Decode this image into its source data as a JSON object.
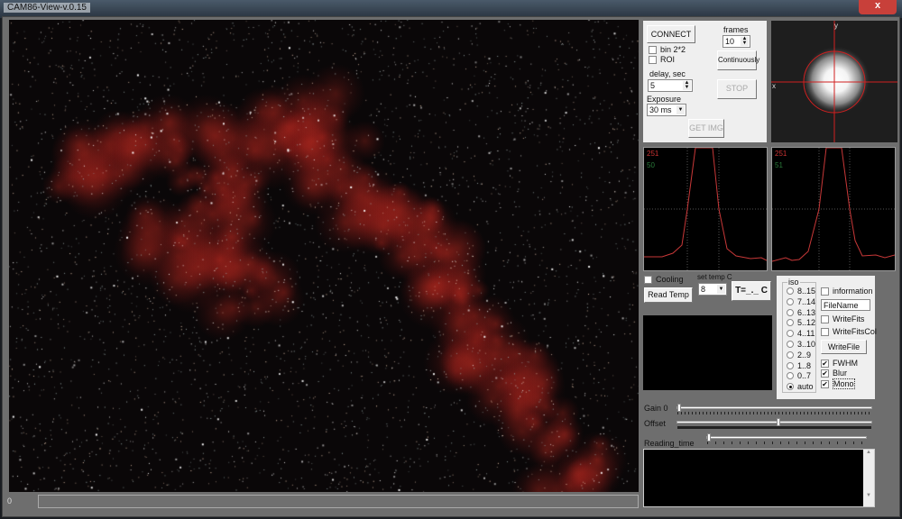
{
  "window": {
    "title": "CAM86-View-v.0.15",
    "close": "x"
  },
  "progress": {
    "value": "0",
    "fraction": 0
  },
  "controls": {
    "connect": "CONNECT",
    "bin": {
      "label": "bin 2*2",
      "checked": false
    },
    "roi": {
      "label": "ROI",
      "checked": false
    },
    "delay_label": "delay, sec",
    "delay_value": "5",
    "exposure_label": "Exposure",
    "exposure_value": "30 ms",
    "frames_label": "frames",
    "frames_value": "10",
    "continuously": "Continuously",
    "stop": "STOP",
    "get_img": "GET IMG"
  },
  "preview": {
    "x_label": "x",
    "y_label": "y",
    "crosshair_color": "#d02020"
  },
  "profiles": [
    {
      "max": "251",
      "value": "50"
    },
    {
      "max": "251",
      "value": "51"
    }
  ],
  "cooling": {
    "label": "Cooling",
    "checked": false,
    "read_temp": "Read Temp",
    "set_temp_label": "set temp C",
    "set_temp_value": "8",
    "temp_display": "T=_._ C"
  },
  "iso": {
    "title": "iso",
    "options": [
      "8..15",
      "7..14",
      "6..13",
      "5..12",
      "4..11",
      "3..10",
      "2..9",
      "1..8",
      "0..7",
      "auto"
    ],
    "selected": "auto"
  },
  "file": {
    "information": {
      "label": "information",
      "checked": false
    },
    "filename": "FileName",
    "write_fits": {
      "label": "WriteFits",
      "checked": false
    },
    "write_fits_col": {
      "label": "WriteFitsCol",
      "checked": false
    },
    "write_file": "WriteFile",
    "fwhm": {
      "label": "FWHM",
      "checked": true
    },
    "blur": {
      "label": "Blur",
      "checked": true
    },
    "mono": {
      "label": "Mono",
      "checked": true
    }
  },
  "sliders": {
    "gain": {
      "label": "Gain 0",
      "value": 0
    },
    "offset": {
      "label": "Offset",
      "fraction": 0.52
    },
    "reading_time": {
      "label": "Reading_time",
      "fraction": 0
    }
  }
}
